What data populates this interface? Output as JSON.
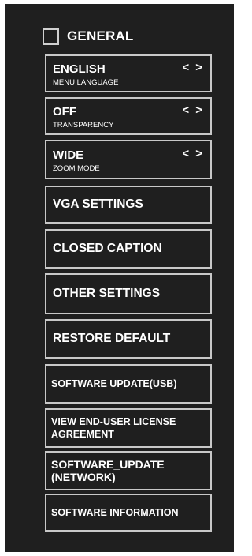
{
  "menu": {
    "title": "GENERAL",
    "items": [
      {
        "label": "ENGLISH",
        "sublabel": "MENU LANGUAGE",
        "arrows": "< >"
      },
      {
        "label": "OFF",
        "sublabel": "TRANSPARENCY",
        "arrows": "< >"
      },
      {
        "label": "WIDE",
        "sublabel": "ZOOM MODE",
        "arrows": "< >"
      },
      {
        "label": "VGA SETTINGS"
      },
      {
        "label": "CLOSED CAPTION"
      },
      {
        "label": "OTHER SETTINGS"
      },
      {
        "label": "RESTORE DEFAULT"
      },
      {
        "label": "SOFTWARE UPDATE(USB)"
      },
      {
        "label_line1": "VIEW END-USER LICENSE",
        "label_line2": "AGREEMENT"
      },
      {
        "label_line1": "SOFTWARE_UPDATE",
        "label_line2": "(NETWORK)"
      },
      {
        "label": "SOFTWARE INFORMATION"
      }
    ]
  },
  "colors": {
    "panel_background": "#1f1f1f",
    "text": "#ffffff",
    "border": "#c8c8c8"
  }
}
